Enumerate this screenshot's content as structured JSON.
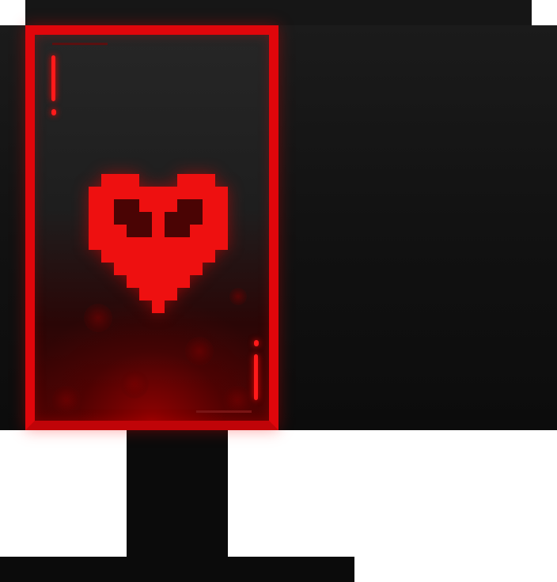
{
  "scene": {
    "card": {
      "suit_icon": "pixel-heart-icon",
      "corner_mark": "!",
      "colors": {
        "accent": "#e0060b",
        "heart_fill": "#ee1010",
        "heart_shade": "#4a0404",
        "card_face": "#222222",
        "glow": "#b00000"
      }
    }
  }
}
